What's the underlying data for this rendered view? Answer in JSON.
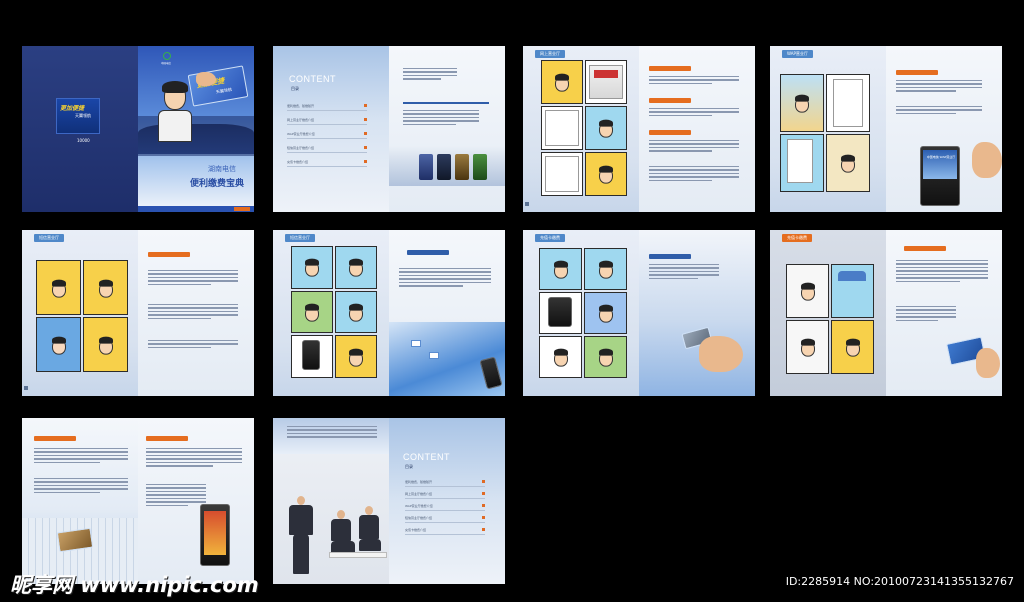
{
  "cover": {
    "brand_text": "中国电信",
    "slogan_main": "更加便捷",
    "slogan_sub": "天翼领航",
    "tagline_main": "湖南电信",
    "tagline_sub": "便利缴费宝典",
    "hotline": "10000"
  },
  "toc_1": {
    "title_en": "CONTENT",
    "title_cn": "目录",
    "items": [
      "便利缴费，随缴随开",
      "网上营业厅缴费介绍",
      "WAP营业厅缴费介绍",
      "短信营业厅缴费介绍",
      "充值卡缴费介绍"
    ]
  },
  "spread_2": {
    "tab": "网上营业厅"
  },
  "spread_3": {
    "tab": "WAP营业厅",
    "phone_text": "中国电信 WAP营业厅"
  },
  "spread_4": {
    "tab": "短信营业厅"
  },
  "spread_5": {
    "tab": "短信营业厅"
  },
  "spread_6": {
    "tab": "充值卡缴费"
  },
  "spread_7": {
    "tab": "充值卡缴费"
  },
  "toc_2": {
    "title_en": "CONTENT",
    "title_cn": "目录"
  },
  "watermark": {
    "left": "昵享网 www.nipic.com",
    "right": "ID:2285914 NO:20100723141355132767"
  }
}
